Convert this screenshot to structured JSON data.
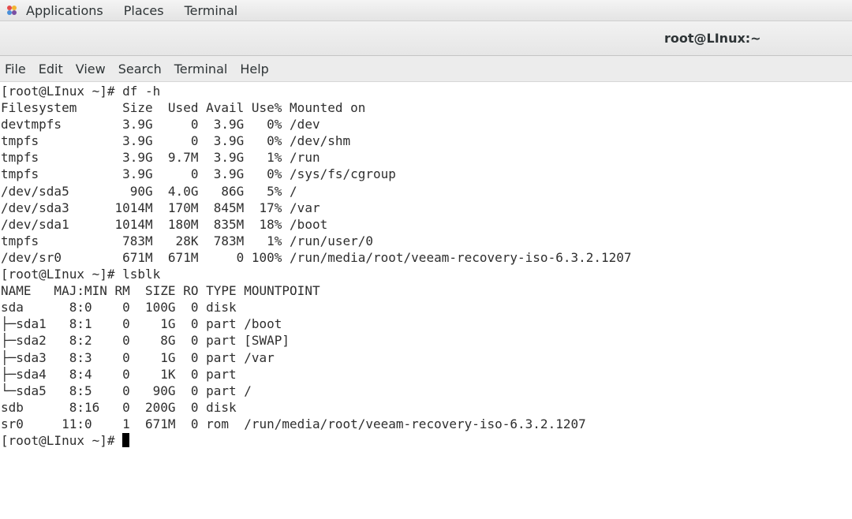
{
  "topbar": {
    "applications": "Applications",
    "places": "Places",
    "terminal": "Terminal"
  },
  "window": {
    "title": "root@LInux:~"
  },
  "menubar": {
    "items": [
      "File",
      "Edit",
      "View",
      "Search",
      "Terminal",
      "Help"
    ]
  },
  "terminal": {
    "lines": [
      "[root@LInux ~]# df -h",
      "Filesystem      Size  Used Avail Use% Mounted on",
      "devtmpfs        3.9G     0  3.9G   0% /dev",
      "tmpfs           3.9G     0  3.9G   0% /dev/shm",
      "tmpfs           3.9G  9.7M  3.9G   1% /run",
      "tmpfs           3.9G     0  3.9G   0% /sys/fs/cgroup",
      "/dev/sda5        90G  4.0G   86G   5% /",
      "/dev/sda3      1014M  170M  845M  17% /var",
      "/dev/sda1      1014M  180M  835M  18% /boot",
      "tmpfs           783M   28K  783M   1% /run/user/0",
      "/dev/sr0        671M  671M     0 100% /run/media/root/veeam-recovery-iso-6.3.2.1207",
      "[root@LInux ~]# lsblk",
      "NAME   MAJ:MIN RM  SIZE RO TYPE MOUNTPOINT",
      "sda      8:0    0  100G  0 disk",
      "├─sda1   8:1    0    1G  0 part /boot",
      "├─sda2   8:2    0    8G  0 part [SWAP]",
      "├─sda3   8:3    0    1G  0 part /var",
      "├─sda4   8:4    0    1K  0 part",
      "└─sda5   8:5    0   90G  0 part /",
      "sdb      8:16   0  200G  0 disk",
      "sr0     11:0    1  671M  0 rom  /run/media/root/veeam-recovery-iso-6.3.2.1207"
    ],
    "prompt": "[root@LInux ~]# "
  }
}
